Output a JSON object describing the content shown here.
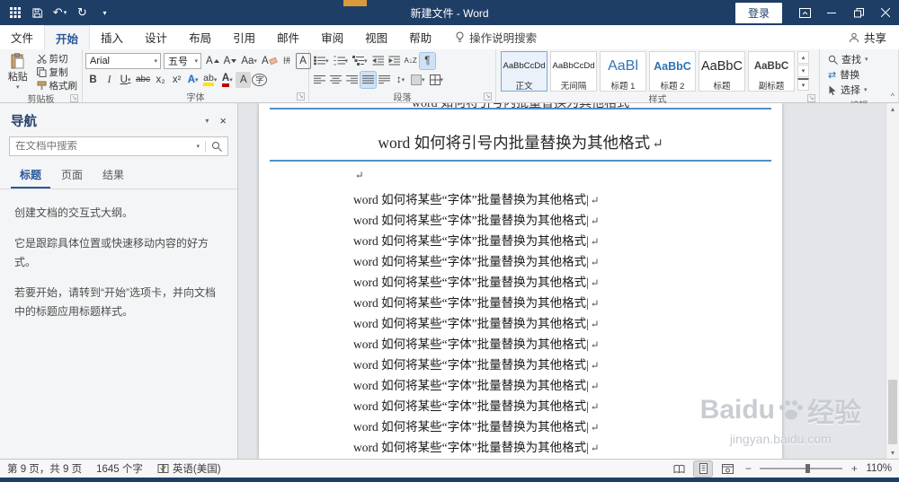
{
  "titlebar": {
    "title": "新建文件 - Word",
    "login_label": "登录"
  },
  "tabs": {
    "file": "文件",
    "items": [
      "开始",
      "插入",
      "设计",
      "布局",
      "引用",
      "邮件",
      "审阅",
      "视图",
      "帮助"
    ],
    "active": "开始",
    "tellme": "操作说明搜索",
    "share": "共享"
  },
  "ribbon": {
    "clipboard": {
      "label": "剪贴板",
      "paste": "粘贴",
      "cut": "剪切",
      "copy": "复制",
      "format_painter": "格式刷"
    },
    "font": {
      "label": "字体",
      "family": "Arial",
      "size": "五号"
    },
    "paragraph": {
      "label": "段落"
    },
    "styles": {
      "label": "样式",
      "items": [
        {
          "preview": "AaBbCcDd",
          "name": "正文",
          "variant": "body"
        },
        {
          "preview": "AaBbCcDd",
          "name": "无间隔",
          "variant": "body"
        },
        {
          "preview": "AaBl",
          "name": "标题 1",
          "variant": "h1"
        },
        {
          "preview": "AaBbC",
          "name": "标题 2",
          "variant": "h2"
        },
        {
          "preview": "AaBbC",
          "name": "标题",
          "variant": "title"
        },
        {
          "preview": "AaBbC",
          "name": "副标题",
          "variant": "subtitle"
        }
      ]
    },
    "editing": {
      "label": "编辑",
      "find": "查找",
      "replace": "替换",
      "select": "选择"
    }
  },
  "navpane": {
    "title": "导航",
    "search_placeholder": "在文档中搜索",
    "tabs": [
      {
        "label": "标题",
        "active": true
      },
      {
        "label": "页面",
        "active": false
      },
      {
        "label": "结果",
        "active": false
      }
    ],
    "paragraphs": [
      "创建文档的交互式大纲。",
      "它是跟踪具体位置或快速移动内容的好方式。",
      "若要开始，请转到“开始”选项卡，并向文档中的标题应用标题样式。"
    ]
  },
  "document": {
    "prev_fragment": "word 如何将引号内批量替换为其他格式",
    "heading": "word 如何将引号内批量替换为其他格式",
    "pilcrow": "↵",
    "body_line": "word 如何将某些“字体”批量替换为其他格式|",
    "body_line_count": 13
  },
  "statusbar": {
    "page_info": "第 9 页，共 9 页",
    "word_count": "1645 个字",
    "language": "英语(美国)",
    "zoom_out": "−",
    "zoom_in": "+",
    "zoom_level": "110%"
  },
  "watermark": {
    "brand_left": "Baidu",
    "brand_right": "经验",
    "url": "jingyan.baidu.com"
  },
  "icons": {
    "caret": "▾",
    "up": "▴",
    "down": "▾",
    "undo": "↶",
    "redo": "↻",
    "letter_a": "A",
    "change_case": "Aa",
    "phonetic": "拼",
    "enclose": "字",
    "bold": "B",
    "italic": "I",
    "underline": "U",
    "strikethrough": "abc",
    "subscript": "x₂",
    "superscript": "x²",
    "highlight": "ab",
    "pilcrow_toggle": "¶",
    "sort": "A↓Z",
    "line_spacing": "↕",
    "close": "×",
    "collapse": "^",
    "launcher": "↘",
    "replace_arrows": "⇄"
  },
  "colors": {
    "accent": "#2b579a",
    "titlebar": "#1e3e66",
    "heading_rule": "#4f8fc7"
  }
}
